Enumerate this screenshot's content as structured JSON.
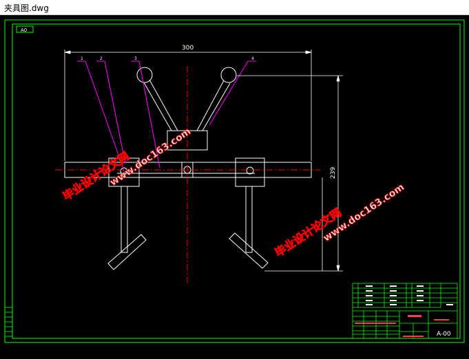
{
  "window": {
    "title": "夹具图.dwg"
  },
  "colors": {
    "canvas_bg": "#000000",
    "frame": "#00ff00",
    "geometry": "#ffffff",
    "centerline": "#ff0000",
    "leader": "#ff00ff",
    "dimension": "#ffffff",
    "watermark_fill": "#ffffff",
    "watermark_stroke": "#ff0000"
  },
  "drawing": {
    "sheet_label": "A0",
    "dim_width": "300",
    "dim_height": "239",
    "part_numbers": [
      "1",
      "2",
      "3",
      "4"
    ],
    "drawing_number": "A-00"
  },
  "watermarks": [
    {
      "line1": "毕业设计论文网",
      "line2": "www.doc163.com"
    },
    {
      "line1": "毕业设计论文网",
      "line2": "www.doc163.com"
    }
  ]
}
